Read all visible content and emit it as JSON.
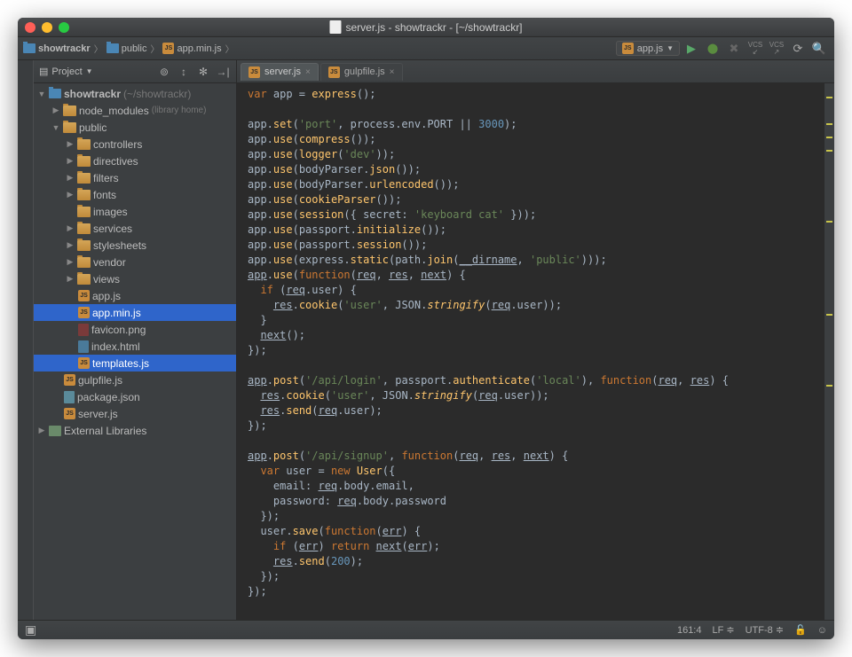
{
  "window": {
    "title": "server.js - showtrackr - [~/showtrackr]"
  },
  "breadcrumb": {
    "project": "showtrackr",
    "folder": "public",
    "file": "app.min.js"
  },
  "toolbar": {
    "run_config": "app.js"
  },
  "sidebar": {
    "title": "Project",
    "root": "showtrackr",
    "root_path": "(~/showtrackr)",
    "node_modules": "node_modules",
    "node_modules_hint": "(library home)",
    "public": "public",
    "folders": [
      "controllers",
      "directives",
      "filters",
      "fonts",
      "images",
      "services",
      "stylesheets",
      "vendor",
      "views"
    ],
    "app_js": "app.js",
    "app_min_js": "app.min.js",
    "favicon": "favicon.png",
    "index_html": "index.html",
    "templates_js": "templates.js",
    "gulpfile": "gulpfile.js",
    "package_json": "package.json",
    "server_js": "server.js",
    "external": "External Libraries"
  },
  "tabs": {
    "active": "server.js",
    "inactive": "gulpfile.js"
  },
  "code_lines": [
    {
      "t": "<kw>var</kw> app = <fn>express</fn>();"
    },
    {
      "t": ""
    },
    {
      "t": "app.<fn>set</fn>(<str>'port'</str>, process.env.PORT || <num>3000</num>);"
    },
    {
      "t": "app.<fn>use</fn>(<fn>compress</fn>());"
    },
    {
      "t": "app.<fn>use</fn>(<fn>logger</fn>(<str>'dev'</str>));"
    },
    {
      "t": "app.<fn>use</fn>(bodyParser.<fn>json</fn>());"
    },
    {
      "t": "app.<fn>use</fn>(bodyParser.<fn>urlencoded</fn>());"
    },
    {
      "t": "app.<fn>use</fn>(<fn>cookieParser</fn>());"
    },
    {
      "t": "app.<fn>use</fn>(<fn>session</fn>({ secret: <str>'keyboard cat'</str> }));"
    },
    {
      "t": "app.<fn>use</fn>(passport.<fn>initialize</fn>());"
    },
    {
      "t": "app.<fn>use</fn>(passport.<fn>session</fn>());"
    },
    {
      "t": "app.<fn>use</fn>(express.<fn>static</fn>(path.<fn>join</fn>(<und>__dirname</und>, <str>'public'</str>)));"
    },
    {
      "t": "<und>app</und>.<fn>use</fn>(<kw>function</kw>(<und>req</und>, <und>res</und>, <und>next</und>) {"
    },
    {
      "t": "  <kw>if</kw> (<und>req</und>.user) {"
    },
    {
      "t": "    <und>res</und>.<fn>cookie</fn>(<str>'user'</str>, JSON.<fn it>stringify</fn>(<und>req</und>.user));"
    },
    {
      "t": "  }"
    },
    {
      "t": "  <und>next</und>();"
    },
    {
      "t": "});"
    },
    {
      "t": ""
    },
    {
      "t": "<und>app</und>.<fn>post</fn>(<str>'/api/login'</str>, passport.<fn>authenticate</fn>(<str>'local'</str>), <kw>function</kw>(<und>req</und>, <und>res</und>) {"
    },
    {
      "t": "  <und>res</und>.<fn>cookie</fn>(<str>'user'</str>, JSON.<fn it>stringify</fn>(<und>req</und>.user));"
    },
    {
      "t": "  <und>res</und>.<fn>send</fn>(<und>req</und>.user);"
    },
    {
      "t": "});"
    },
    {
      "t": ""
    },
    {
      "t": "<und>app</und>.<fn>post</fn>(<str>'/api/signup'</str>, <kw>function</kw>(<und>req</und>, <und>res</und>, <und>next</und>) {"
    },
    {
      "t": "  <kw>var</kw> user = <kw>new</kw> <fn>User</fn>({"
    },
    {
      "t": "    email: <und>req</und>.body.email,"
    },
    {
      "t": "    password: <und>req</und>.body.password"
    },
    {
      "t": "  });"
    },
    {
      "t": "  user.<fn>save</fn>(<kw>function</kw>(<und>err</und>) {"
    },
    {
      "t": "    <kw>if</kw> (<und>err</und>) <kw>return</kw> <und>next</und>(<und>err</und>);"
    },
    {
      "t": "    <und>res</und>.<fn>send</fn>(<num>200</num>);"
    },
    {
      "t": "  });"
    },
    {
      "t": "});"
    }
  ],
  "statusbar": {
    "position": "161:4",
    "line_sep": "LF",
    "encoding": "UTF-8"
  }
}
